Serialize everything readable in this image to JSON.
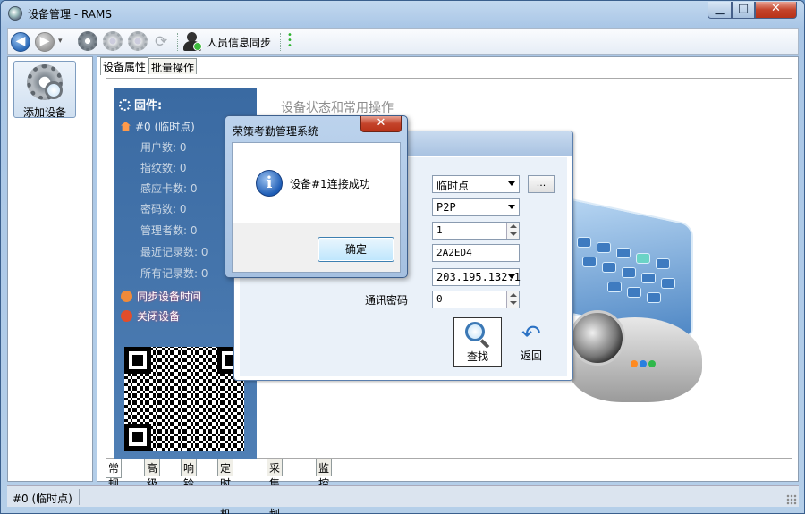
{
  "window": {
    "title": "设备管理 - RAMS",
    "min": "▁",
    "max": "□",
    "close": "✕"
  },
  "toolbar": {
    "sync_label": "人员信息同步",
    "back": "◀",
    "forward": "▶",
    "dropdown": "▾",
    "refresh": "⟳"
  },
  "sidebar": {
    "add_device_label": "添加设备"
  },
  "tabs": [
    "设备属性",
    "批量操作"
  ],
  "device_panel": {
    "firmware_title": "固件:",
    "device_line": "#0 (临时点)",
    "stats": [
      "用户数: 0",
      "指纹数: 0",
      "感应卡数: 0",
      "密码数: 0",
      "管理者数: 0",
      "最近记录数: 0",
      "所有记录数: 0"
    ],
    "actions": [
      "同步设备时间",
      "关闭设备"
    ]
  },
  "status_section_title": "设备状态和常用操作",
  "connect_form": {
    "location_value": "临时点",
    "dots_label": "...",
    "protocol_value": "P2P",
    "number_value": "1",
    "serial_value": "2A2ED4",
    "server_value": "203.195.132.1",
    "password_label": "通讯密码",
    "password_value": "0",
    "find_label": "查找",
    "back_label": "返回",
    "back_arrow": "↶"
  },
  "bottom_tabs": [
    "常规",
    "高级",
    "响铃",
    "定时关机",
    "采集计划",
    "监控"
  ],
  "statusbar": {
    "text": "#0 (临时点)"
  },
  "message_box": {
    "title": "荣策考勤管理系统",
    "close": "✕",
    "icon_glyph": "i",
    "message": "设备#1连接成功",
    "ok_label": "确定"
  },
  "colors": {
    "sidebar_blue": "#3a6aa2",
    "accent": "#2b72c4"
  }
}
